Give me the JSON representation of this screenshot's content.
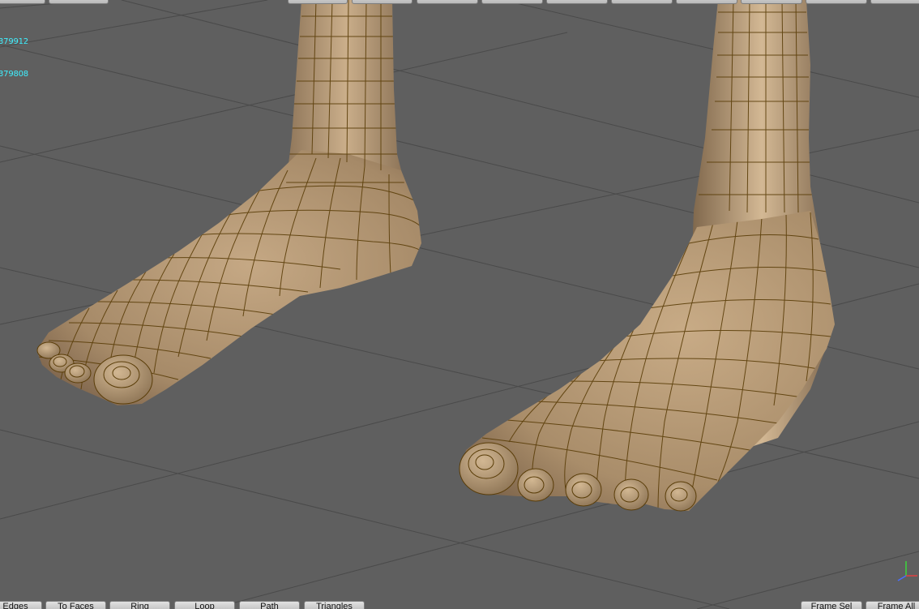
{
  "hud": {
    "line1": "379912",
    "line2": "379808"
  },
  "top_toolbar": {
    "buttons": [
      "",
      "",
      "",
      "",
      "",
      "",
      "",
      "",
      "",
      "",
      "",
      "",
      "",
      ""
    ]
  },
  "bottom_toolbar": {
    "left_buttons": [
      "Edges",
      "To Faces",
      "Ring",
      "Loop",
      "Path",
      "Triangles"
    ],
    "right_buttons": [
      "Frame Sel",
      "Frame All"
    ]
  },
  "colors": {
    "viewport_bg": "#5f5f5f",
    "grid": "#4a4a4a",
    "skin": "#b49a78",
    "wire": "#5a3d08",
    "hud_text": "#3ff0ff"
  },
  "icons": {
    "axis_gizmo": "xyz-axis-icon"
  }
}
